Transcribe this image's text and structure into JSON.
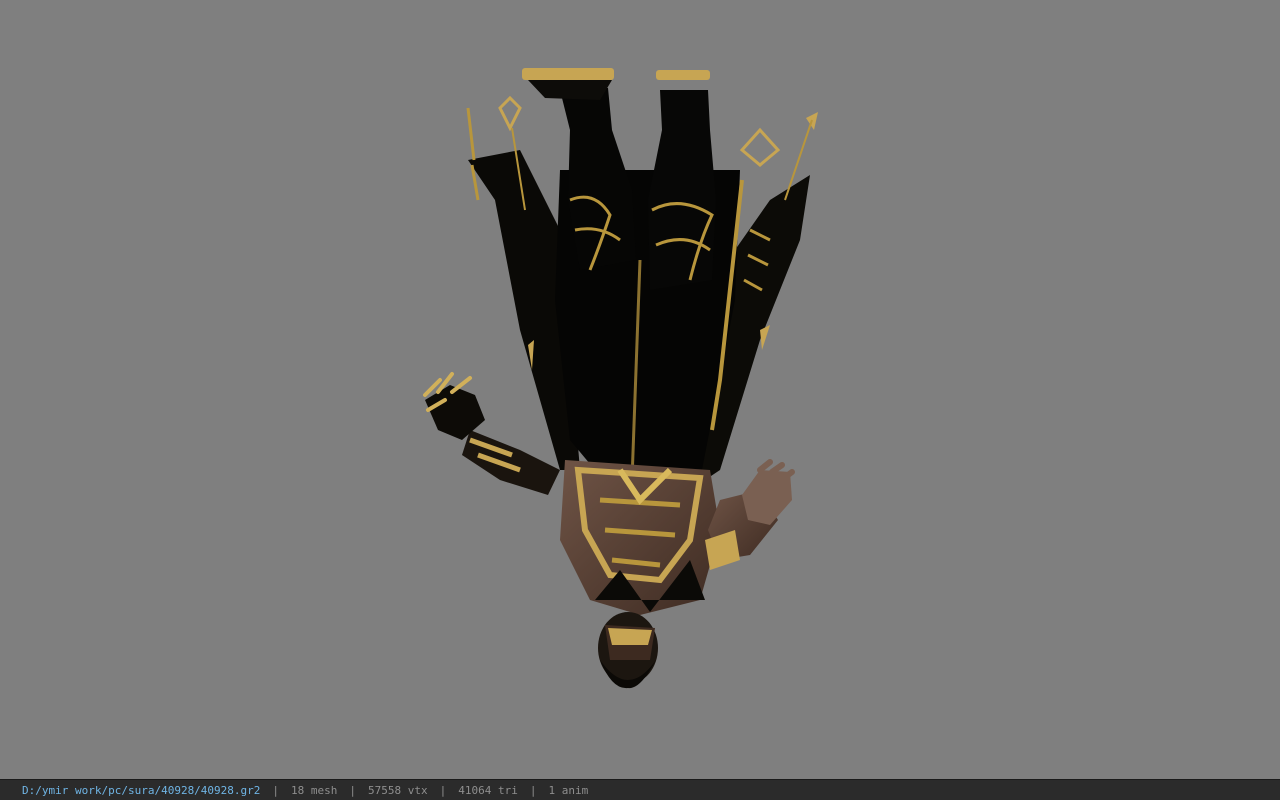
{
  "viewer": {
    "background_color": "#7f7f7f",
    "model": "character-armor-gold-black"
  },
  "status_bar": {
    "file_path": "D:/ymir work/pc/sura/40928/40928.gr2",
    "separator": "|",
    "mesh": "18 mesh",
    "vtx": "57558 vtx",
    "tri": "41064 tri",
    "anim": "1 anim",
    "path_color": "#6fb4e4",
    "text_color": "#8e8e8e"
  }
}
